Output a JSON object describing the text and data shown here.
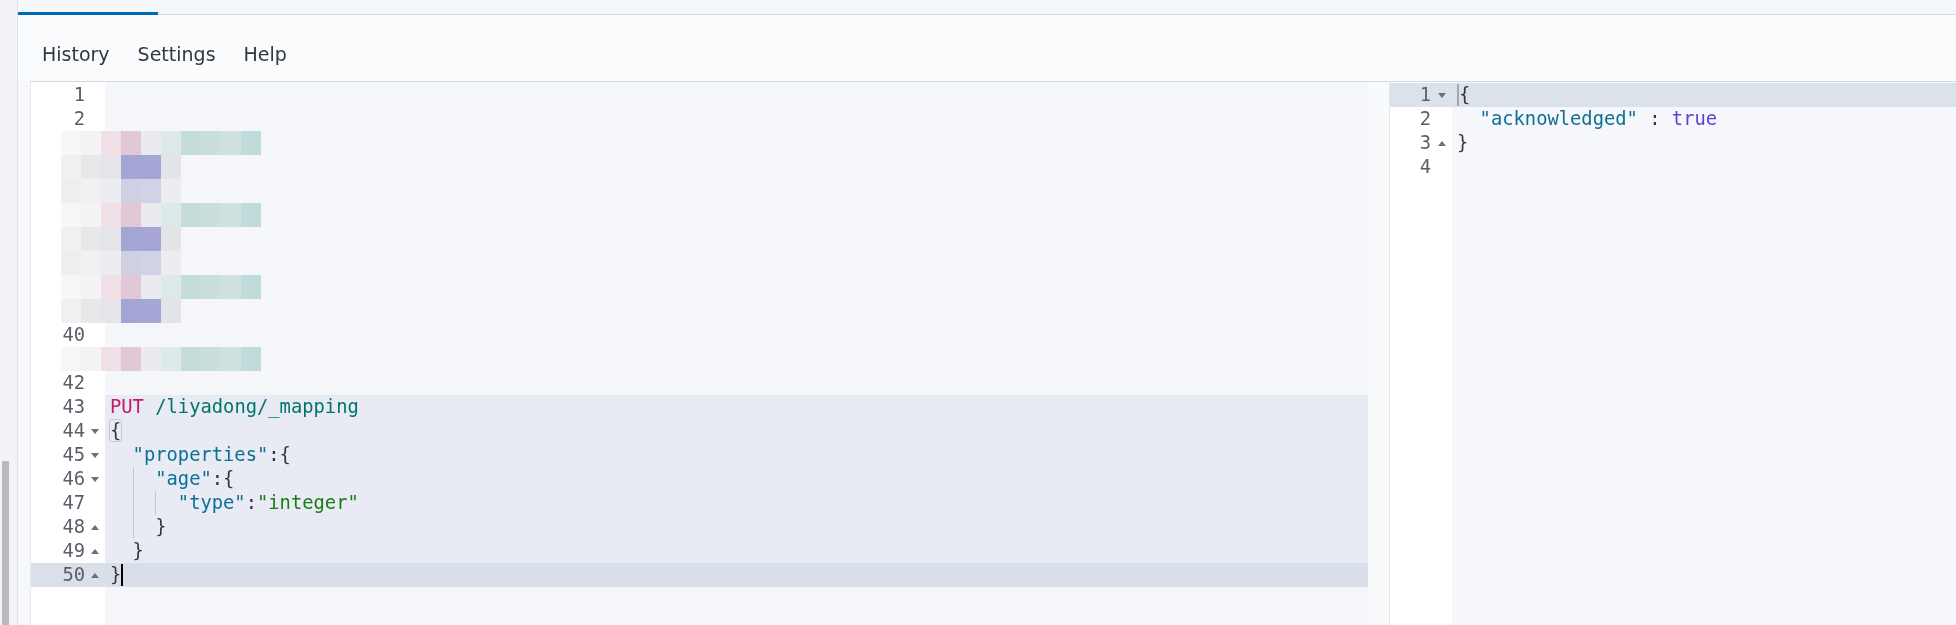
{
  "menu": [
    "History",
    "Settings",
    "Help"
  ],
  "request_editor": {
    "focused": true,
    "lines": [
      {
        "kind": "code",
        "number": "1",
        "selected": false,
        "active": false,
        "fold_start": false,
        "fold_end": false
      },
      {
        "kind": "code",
        "number": "2",
        "selected": false,
        "active": false,
        "fold_start": false,
        "fold_end": false
      },
      {
        "kind": "redacted",
        "selected": false,
        "active": false
      },
      {
        "kind": "redacted",
        "selected": false,
        "active": false
      },
      {
        "kind": "redacted",
        "selected": false,
        "active": false
      },
      {
        "kind": "redacted",
        "selected": false,
        "active": false
      },
      {
        "kind": "redacted",
        "selected": false,
        "active": false
      },
      {
        "kind": "redacted",
        "selected": false,
        "active": false
      },
      {
        "kind": "redacted",
        "selected": false,
        "active": false
      },
      {
        "kind": "redacted",
        "selected": false,
        "active": false
      },
      {
        "kind": "code",
        "number": "40",
        "selected": false,
        "active": false,
        "fold_start": false,
        "fold_end": false
      },
      {
        "kind": "redacted",
        "selected": false,
        "active": false
      },
      {
        "kind": "code",
        "number": "42",
        "selected": false,
        "active": false,
        "fold_start": false,
        "fold_end": false
      },
      {
        "kind": "code",
        "number": "43",
        "selected": true,
        "active": false,
        "fold_start": false,
        "fold_end": false,
        "tokens": [
          {
            "kind": "method",
            "text": "PUT"
          },
          {
            "kind": "url",
            "text": " /liyadong/_mapping"
          }
        ]
      },
      {
        "kind": "code",
        "number": "44",
        "selected": true,
        "active": false,
        "fold_start": true,
        "fold_end": false,
        "tokens": [
          {
            "kind": "punct",
            "text": "{",
            "matched": true
          }
        ],
        "children": [
          {
            "kind": "code",
            "number": "45",
            "selected": true,
            "active": false,
            "fold_start": true,
            "fold_end": false,
            "tokens": [
              {
                "kind": "key",
                "text": "\"properties\""
              },
              {
                "kind": "punct",
                "text": ":{"
              }
            ],
            "children": [
              {
                "kind": "code",
                "number": "46",
                "selected": true,
                "active": false,
                "fold_start": true,
                "fold_end": false,
                "tokens": [
                  {
                    "kind": "key",
                    "text": "\"age\""
                  },
                  {
                    "kind": "punct",
                    "text": ":{"
                  }
                ],
                "children": [
                  {
                    "kind": "code",
                    "number": "47",
                    "selected": true,
                    "active": false,
                    "fold_start": false,
                    "fold_end": false,
                    "tokens": [
                      {
                        "kind": "key",
                        "text": "\"type\""
                      },
                      {
                        "kind": "punct",
                        "text": ":"
                      },
                      {
                        "kind": "string",
                        "text": "\"integer\""
                      }
                    ]
                  }
                ]
              },
              {
                "kind": "code",
                "number": "48",
                "selected": true,
                "active": false,
                "fold_start": false,
                "fold_end": true,
                "tokens": [
                  {
                    "kind": "punct",
                    "text": "}"
                  }
                ]
              }
            ]
          },
          {
            "kind": "code",
            "number": "49",
            "selected": true,
            "active": false,
            "fold_start": false,
            "fold_end": true,
            "tokens": [
              {
                "kind": "punct",
                "text": "}"
              }
            ]
          }
        ]
      },
      {
        "kind": "code",
        "number": "50",
        "selected": true,
        "active": true,
        "fold_start": false,
        "fold_end": true,
        "tokens": [
          {
            "kind": "punct",
            "text": "}"
          },
          {
            "kind": "cursor"
          }
        ]
      }
    ]
  },
  "response_editor": {
    "focused": false,
    "lines": [
      {
        "kind": "code",
        "number": "1",
        "active": true,
        "fold_start": true,
        "fold_end": false,
        "tokens": [
          {
            "kind": "cursor"
          },
          {
            "kind": "punct",
            "text": "{"
          }
        ],
        "children": [
          {
            "kind": "code",
            "number": "2",
            "active": false,
            "fold_start": false,
            "fold_end": false,
            "tokens": [
              {
                "kind": "key",
                "text": "\"acknowledged\""
              },
              {
                "kind": "punct",
                "text": " : "
              },
              {
                "kind": "boolean",
                "text": "true"
              }
            ]
          }
        ]
      },
      {
        "kind": "code",
        "number": "3",
        "active": false,
        "fold_start": false,
        "fold_end": true,
        "tokens": [
          {
            "kind": "punct",
            "text": "}"
          }
        ]
      },
      {
        "kind": "code",
        "number": "4",
        "active": false,
        "fold_start": false,
        "fold_end": false
      }
    ]
  }
}
